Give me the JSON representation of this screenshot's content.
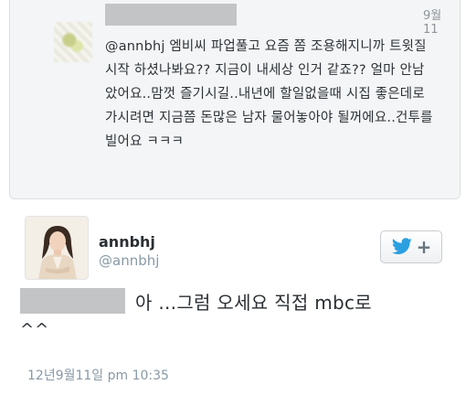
{
  "reply": {
    "date": "9월 11",
    "text": "@annbhj 엠비씨 파업풀고 요즘 쫌 조용해지니까 트윗질 시작 하셨나봐요?? 지금이 내세상 인거 같죠?? 얼마 안남았어요..맘껏 즐기시길..내년에 할일없을때 시집 좋은데로 가시려면 지금쯤 돈많은 남자 물어놓아야 될꺼에요..건투를 빌어요 ㅋㅋㅋ"
  },
  "tweet": {
    "author_name": "annbhj",
    "author_handle": "@annbhj",
    "text_line1": "아 ...그럼 오세요 직접 mbc로",
    "text_line2": "^^",
    "timestamp": "12년9월11일 pm 10:35"
  },
  "follow_button": {
    "icon": "twitter-bird-icon",
    "plus": "+"
  },
  "colors": {
    "twitter_blue": "#2b9fe0",
    "redaction_gray": "#c3c4c6",
    "meta_gray": "#8899a6",
    "card_bg": "#f4f5f6"
  }
}
